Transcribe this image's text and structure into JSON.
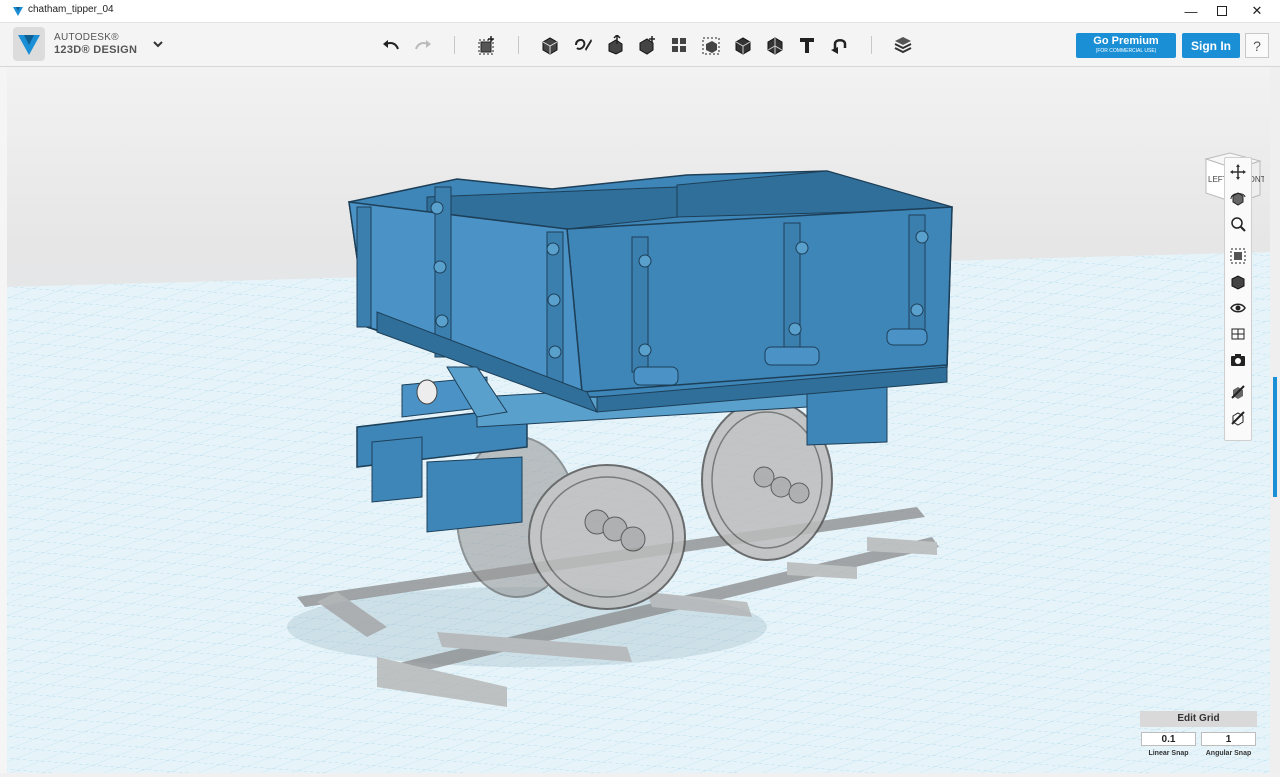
{
  "window": {
    "title": "chatham_tipper_04"
  },
  "brand": {
    "line1": "AUTODESK®",
    "line2": "123D® DESIGN"
  },
  "toolbar": {
    "tools": [
      "undo-icon",
      "redo-icon",
      "transform-icon",
      "primitives-icon",
      "sketch-icon",
      "construct-icon",
      "modify-icon",
      "pattern-icon",
      "group-icon",
      "combine-icon",
      "measure-icon",
      "text-icon",
      "snap-icon",
      "material-icon"
    ]
  },
  "header": {
    "premium_label": "Go Premium",
    "premium_sub": "(FOR COMMERCIAL USE)",
    "signin_label": "Sign In",
    "help_label": "?"
  },
  "viewcube": {
    "left": "LEFT",
    "front": "FRONT"
  },
  "navbar": {
    "icons": [
      "pan-icon",
      "orbit-icon",
      "zoom-icon",
      "fit-icon",
      "view-icon",
      "visibility-icon",
      "material-display-icon",
      "screenshot-icon",
      "hide-icon",
      "grid-toggle-icon"
    ]
  },
  "grid": {
    "title": "Edit Grid",
    "linear_value": "0.1",
    "angular_value": "1",
    "linear_label": "Linear Snap",
    "angular_label": "Angular Snap"
  },
  "colors": {
    "accent": "#1a8fd6",
    "model": "#3e86b8",
    "grid": "#9fd2e6"
  }
}
